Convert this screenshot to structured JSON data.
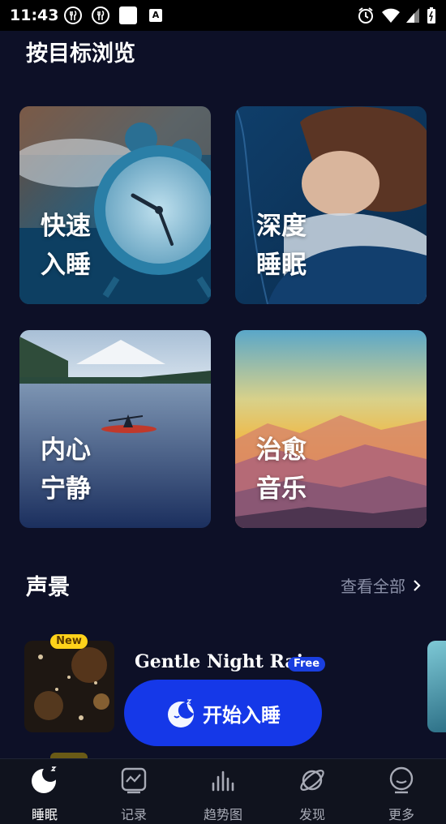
{
  "status_bar": {
    "time": "11:43",
    "notif_a": "A"
  },
  "browse": {
    "title": "按目标浏览",
    "cards": [
      {
        "line1": "快速",
        "line2": "入睡"
      },
      {
        "line1": "深度",
        "line2": "睡眠"
      },
      {
        "line1": "内心",
        "line2": "宁静"
      },
      {
        "line1": "治愈",
        "line2": "音乐"
      }
    ]
  },
  "soundscape": {
    "title": "声景",
    "see_all": "查看全部",
    "item": {
      "badge": "New",
      "title": "Gentle Night Rain",
      "free_badge": "Free",
      "start_label": "开始入睡"
    }
  },
  "nav": {
    "items": [
      {
        "label": "睡眠",
        "active": true
      },
      {
        "label": "记录"
      },
      {
        "label": "趋势图"
      },
      {
        "label": "发现"
      },
      {
        "label": "更多"
      }
    ]
  },
  "colors": {
    "background": "#0d1027",
    "accent": "#1538e8",
    "new_badge": "#ffd21a"
  }
}
